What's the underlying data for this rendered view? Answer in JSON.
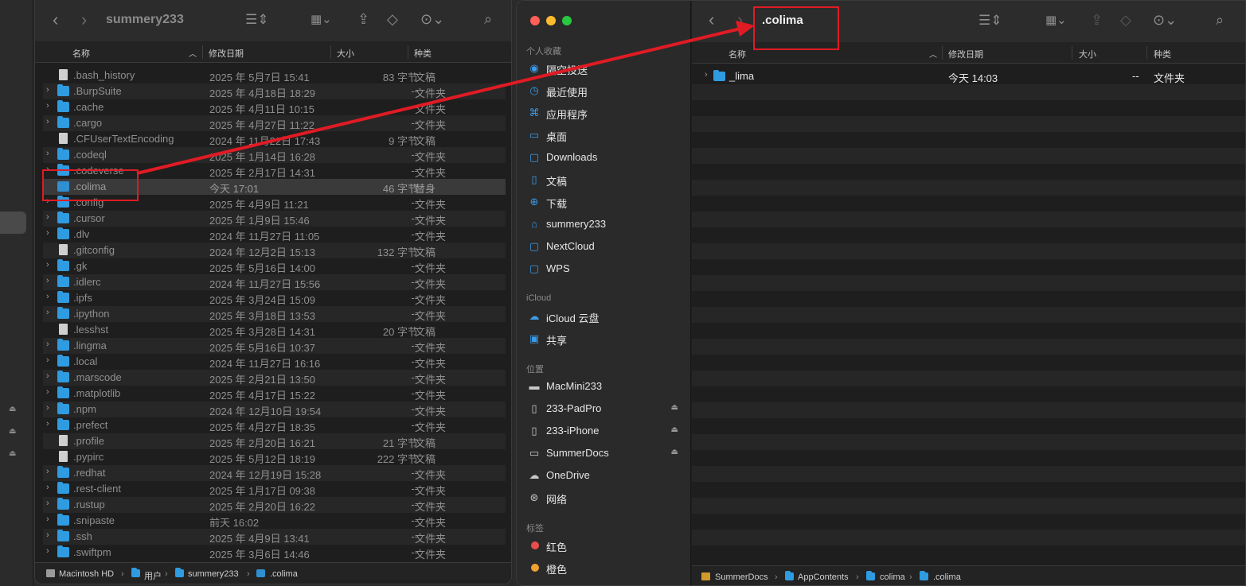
{
  "left_window": {
    "title": "summery233",
    "columns": {
      "name": "名称",
      "date": "修改日期",
      "size": "大小",
      "kind": "种类"
    },
    "rows": [
      {
        "name": ".bash_history",
        "date": "2025 年 5月7日 15:41",
        "size": "83 字节",
        "kind": "文稿",
        "type": "doc"
      },
      {
        "name": ".BurpSuite",
        "date": "2025 年 4月18日 18:29",
        "size": "--",
        "kind": "文件夹",
        "type": "folder"
      },
      {
        "name": ".cache",
        "date": "2025 年 4月11日 10:15",
        "size": "--",
        "kind": "文件夹",
        "type": "folder"
      },
      {
        "name": ".cargo",
        "date": "2025 年 4月27日 11:22",
        "size": "--",
        "kind": "文件夹",
        "type": "folder"
      },
      {
        "name": ".CFUserTextEncoding",
        "date": "2024 年 11月22日 17:43",
        "size": "9 字节",
        "kind": "文稿",
        "type": "doc"
      },
      {
        "name": ".codeql",
        "date": "2025 年 1月14日 16:28",
        "size": "--",
        "kind": "文件夹",
        "type": "folder"
      },
      {
        "name": ".codeverse",
        "date": "2025 年 2月17日 14:31",
        "size": "--",
        "kind": "文件夹",
        "type": "folder"
      },
      {
        "name": ".colima",
        "date": "今天 17:01",
        "size": "46 字节",
        "kind": "替身",
        "type": "alias"
      },
      {
        "name": ".config",
        "date": "2025 年 4月9日 11:21",
        "size": "--",
        "kind": "文件夹",
        "type": "folder"
      },
      {
        "name": ".cursor",
        "date": "2025 年 1月9日 15:46",
        "size": "--",
        "kind": "文件夹",
        "type": "folder"
      },
      {
        "name": ".dlv",
        "date": "2024 年 11月27日 11:05",
        "size": "--",
        "kind": "文件夹",
        "type": "folder"
      },
      {
        "name": ".gitconfig",
        "date": "2024 年 12月2日 15:13",
        "size": "132 字节",
        "kind": "文稿",
        "type": "doc"
      },
      {
        "name": ".gk",
        "date": "2025 年 5月16日 14:00",
        "size": "--",
        "kind": "文件夹",
        "type": "folder"
      },
      {
        "name": ".idlerc",
        "date": "2024 年 11月27日 15:56",
        "size": "--",
        "kind": "文件夹",
        "type": "folder"
      },
      {
        "name": ".ipfs",
        "date": "2025 年 3月24日 15:09",
        "size": "--",
        "kind": "文件夹",
        "type": "folder"
      },
      {
        "name": ".ipython",
        "date": "2025 年 3月18日 13:53",
        "size": "--",
        "kind": "文件夹",
        "type": "folder"
      },
      {
        "name": ".lesshst",
        "date": "2025 年 3月28日 14:31",
        "size": "20 字节",
        "kind": "文稿",
        "type": "doc"
      },
      {
        "name": ".lingma",
        "date": "2025 年 5月16日 10:37",
        "size": "--",
        "kind": "文件夹",
        "type": "folder"
      },
      {
        "name": ".local",
        "date": "2024 年 11月27日 16:16",
        "size": "--",
        "kind": "文件夹",
        "type": "folder"
      },
      {
        "name": ".marscode",
        "date": "2025 年 2月21日 13:50",
        "size": "--",
        "kind": "文件夹",
        "type": "folder"
      },
      {
        "name": ".matplotlib",
        "date": "2025 年 4月17日 15:22",
        "size": "--",
        "kind": "文件夹",
        "type": "folder"
      },
      {
        "name": ".npm",
        "date": "2024 年 12月10日 19:54",
        "size": "--",
        "kind": "文件夹",
        "type": "folder"
      },
      {
        "name": ".prefect",
        "date": "2025 年 4月27日 18:35",
        "size": "--",
        "kind": "文件夹",
        "type": "folder"
      },
      {
        "name": ".profile",
        "date": "2025 年 2月20日 16:21",
        "size": "21 字节",
        "kind": "文稿",
        "type": "doc"
      },
      {
        "name": ".pypirc",
        "date": "2025 年 5月12日 18:19",
        "size": "222 字节",
        "kind": "文稿",
        "type": "doc"
      },
      {
        "name": ".redhat",
        "date": "2024 年 12月19日 15:28",
        "size": "--",
        "kind": "文件夹",
        "type": "folder"
      },
      {
        "name": ".rest-client",
        "date": "2025 年 1月17日 09:38",
        "size": "--",
        "kind": "文件夹",
        "type": "folder"
      },
      {
        "name": ".rustup",
        "date": "2025 年 2月20日 16:22",
        "size": "--",
        "kind": "文件夹",
        "type": "folder"
      },
      {
        "name": ".snipaste",
        "date": "前天 16:02",
        "size": "--",
        "kind": "文件夹",
        "type": "folder"
      },
      {
        "name": ".ssh",
        "date": "2025 年 4月9日 13:41",
        "size": "--",
        "kind": "文件夹",
        "type": "folder"
      },
      {
        "name": ".swiftpm",
        "date": "2025 年 3月6日 14:46",
        "size": "--",
        "kind": "文件夹",
        "type": "folder"
      }
    ],
    "path": [
      "Macintosh HD",
      "用户",
      "summery233",
      ".colima"
    ]
  },
  "right_window": {
    "title": ".colima",
    "columns": {
      "name": "名称",
      "date": "修改日期",
      "size": "大小",
      "kind": "种类"
    },
    "rows": [
      {
        "name": "_lima",
        "date": "今天 14:03",
        "size": "--",
        "kind": "文件夹"
      }
    ],
    "path": [
      "SummerDocs",
      "AppContents",
      "colima",
      ".colima"
    ]
  },
  "sidebar": {
    "favorites_header": "个人收藏",
    "favorites": [
      {
        "label": "隔空投送",
        "icon": "airdrop-icon"
      },
      {
        "label": "最近使用",
        "icon": "clock-icon"
      },
      {
        "label": "应用程序",
        "icon": "apps-icon"
      },
      {
        "label": "桌面",
        "icon": "desktop-icon"
      },
      {
        "label": "Downloads",
        "icon": "folder-icon"
      },
      {
        "label": "文稿",
        "icon": "document-icon"
      },
      {
        "label": "下载",
        "icon": "download-icon"
      },
      {
        "label": "summery233",
        "icon": "home-icon"
      },
      {
        "label": "NextCloud",
        "icon": "folder-icon"
      },
      {
        "label": "WPS",
        "icon": "folder-icon"
      }
    ],
    "icloud_header": "iCloud",
    "icloud": [
      {
        "label": "iCloud 云盘",
        "icon": "cloud-icon"
      },
      {
        "label": "共享",
        "icon": "shared-folder-icon"
      }
    ],
    "locations_header": "位置",
    "locations": [
      {
        "label": "MacMini233",
        "icon": "computer-icon",
        "eject": false
      },
      {
        "label": "233-PadPro",
        "icon": "ipad-icon",
        "eject": true
      },
      {
        "label": "233-iPhone",
        "icon": "iphone-icon",
        "eject": true
      },
      {
        "label": "SummerDocs",
        "icon": "drive-icon",
        "eject": true
      },
      {
        "label": "OneDrive",
        "icon": "cloud-icon",
        "eject": false
      },
      {
        "label": "网络",
        "icon": "network-icon",
        "eject": false
      }
    ],
    "tags_header": "标签",
    "tags": [
      {
        "label": "红色",
        "color": "#eb4d4b"
      },
      {
        "label": "橙色",
        "color": "#f0a030"
      }
    ]
  },
  "colors": {
    "annotation_red": "#e01b24",
    "folder_blue": "#2f9be0",
    "accent": "#3b9be8"
  }
}
